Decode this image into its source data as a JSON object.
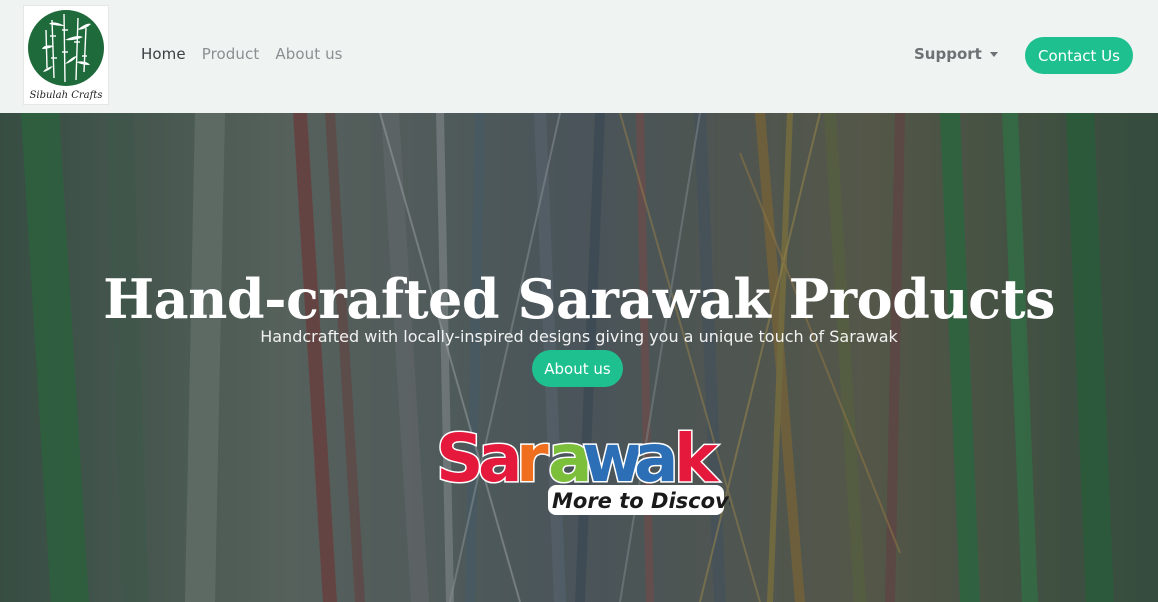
{
  "brand": {
    "logo_text": "Sibulah Crafts",
    "logo_colors": {
      "circle": "#1e6a3a",
      "bamboo": "#ffffff"
    }
  },
  "nav": {
    "links": [
      {
        "label": "Home",
        "active": true
      },
      {
        "label": "Product",
        "active": false
      },
      {
        "label": "About us",
        "active": false
      }
    ],
    "support_label": "Support",
    "contact_label": "Contact Us"
  },
  "hero": {
    "title": "Hand-crafted Sarawak Products",
    "subtitle": "Handcrafted with locally-inspired designs giving you a unique touch of Sarawak",
    "button_label": "About us",
    "badge": {
      "letters": [
        "S",
        "a",
        "r",
        "a",
        "w",
        "a",
        "k"
      ],
      "letter_colors": [
        "#e4193b",
        "#e4193b",
        "#ef6f1f",
        "#7bbf3a",
        "#2d6fb6",
        "#2d6fb6",
        "#e4193b"
      ],
      "tagline": "More to Discover"
    }
  },
  "colors": {
    "accent": "#1fc08f",
    "navbar_bg": "#eff3f2",
    "nav_active": "#3b3f41",
    "nav_muted": "#8a8f91"
  }
}
